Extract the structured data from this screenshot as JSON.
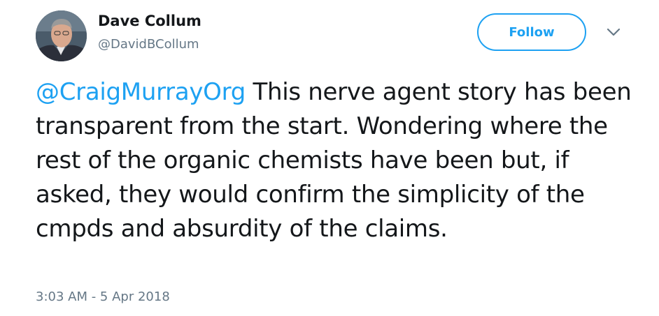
{
  "author": {
    "name": "Dave Collum",
    "handle": "@DavidBCollum",
    "avatar_icon": "user-avatar"
  },
  "actions": {
    "follow_label": "Follow",
    "more_icon": "chevron-down-icon"
  },
  "tweet": {
    "mention": "@CraigMurrayOrg",
    "body": " This nerve agent story has been transparent from the start. Wondering where the rest of the organic chemists have been but, if asked, they would confirm the simplicity of the cmpds and absurdity of the claims.",
    "timestamp": "3:03 AM - 5 Apr 2018"
  },
  "colors": {
    "accent": "#1da1f2",
    "text": "#14171a",
    "secondary": "#657786"
  }
}
